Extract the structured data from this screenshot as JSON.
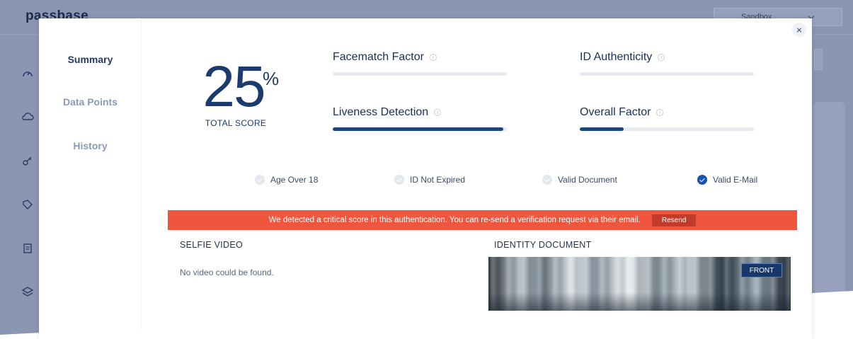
{
  "background": {
    "logo": "passbase",
    "environment": "Sandbox"
  },
  "sidebar": {
    "items": [
      {
        "label": "Summary"
      },
      {
        "label": "Data Points"
      },
      {
        "label": "History"
      }
    ]
  },
  "score": {
    "value": "25",
    "unit": "%",
    "label": "TOTAL SCORE"
  },
  "metrics": [
    {
      "label": "Facematch Factor",
      "progress": 0
    },
    {
      "label": "ID Authenticity",
      "progress": 0
    },
    {
      "label": "Liveness Detection",
      "progress": 0.98
    },
    {
      "label": "Overall Factor",
      "progress": 0.25
    }
  ],
  "checks": [
    {
      "label": "Age Over 18",
      "checked": false
    },
    {
      "label": "ID Not Expired",
      "checked": false
    },
    {
      "label": "Valid Document",
      "checked": false
    },
    {
      "label": "Valid E-Mail",
      "checked": true
    }
  ],
  "alert": {
    "message": "We detected a critical score in this authentication. You can re-send a verification request via their email.",
    "button": "Resend"
  },
  "selfie": {
    "title": "SELFIE VIDEO",
    "empty": "No video could be found."
  },
  "document": {
    "title": "IDENTITY DOCUMENT",
    "tag": "FRONT"
  },
  "colors": {
    "primary": "#1b3b6f",
    "alert": "#f0553d",
    "check_on": "#1552b2"
  }
}
